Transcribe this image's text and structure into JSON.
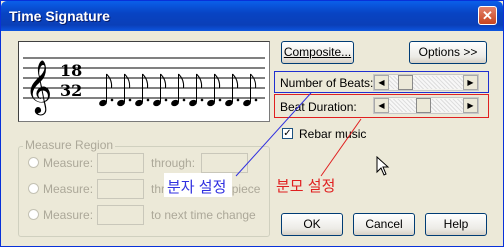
{
  "window": {
    "title": "Time Signature",
    "close_glyph": "✕"
  },
  "staff": {
    "time_sig_top": "18",
    "time_sig_bottom": "32",
    "clef_glyph": "𝄞"
  },
  "buttons": {
    "composite": "Composite...",
    "options": "Options >>",
    "ok": "OK",
    "cancel": "Cancel",
    "help": "Help"
  },
  "settings": {
    "beats_label": "Number of Beats:",
    "duration_label": "Beat Duration:",
    "beats_level": 0.15,
    "duration_level": 0.45,
    "rebar_label": "Rebar music",
    "rebar_checked": true,
    "check_glyph": "✓"
  },
  "measure_region": {
    "title": "Measure Region",
    "options": [
      {
        "label": "Measure:",
        "suffix": "through:"
      },
      {
        "label": "Measure:",
        "suffix": "through end of piece"
      },
      {
        "label": "Measure:",
        "suffix": "to next time change"
      }
    ]
  },
  "annotations": {
    "numerator": "분자 설정",
    "denominator": "분모 설정",
    "numerator_color": "#3030e0",
    "denominator_color": "#e02020"
  }
}
